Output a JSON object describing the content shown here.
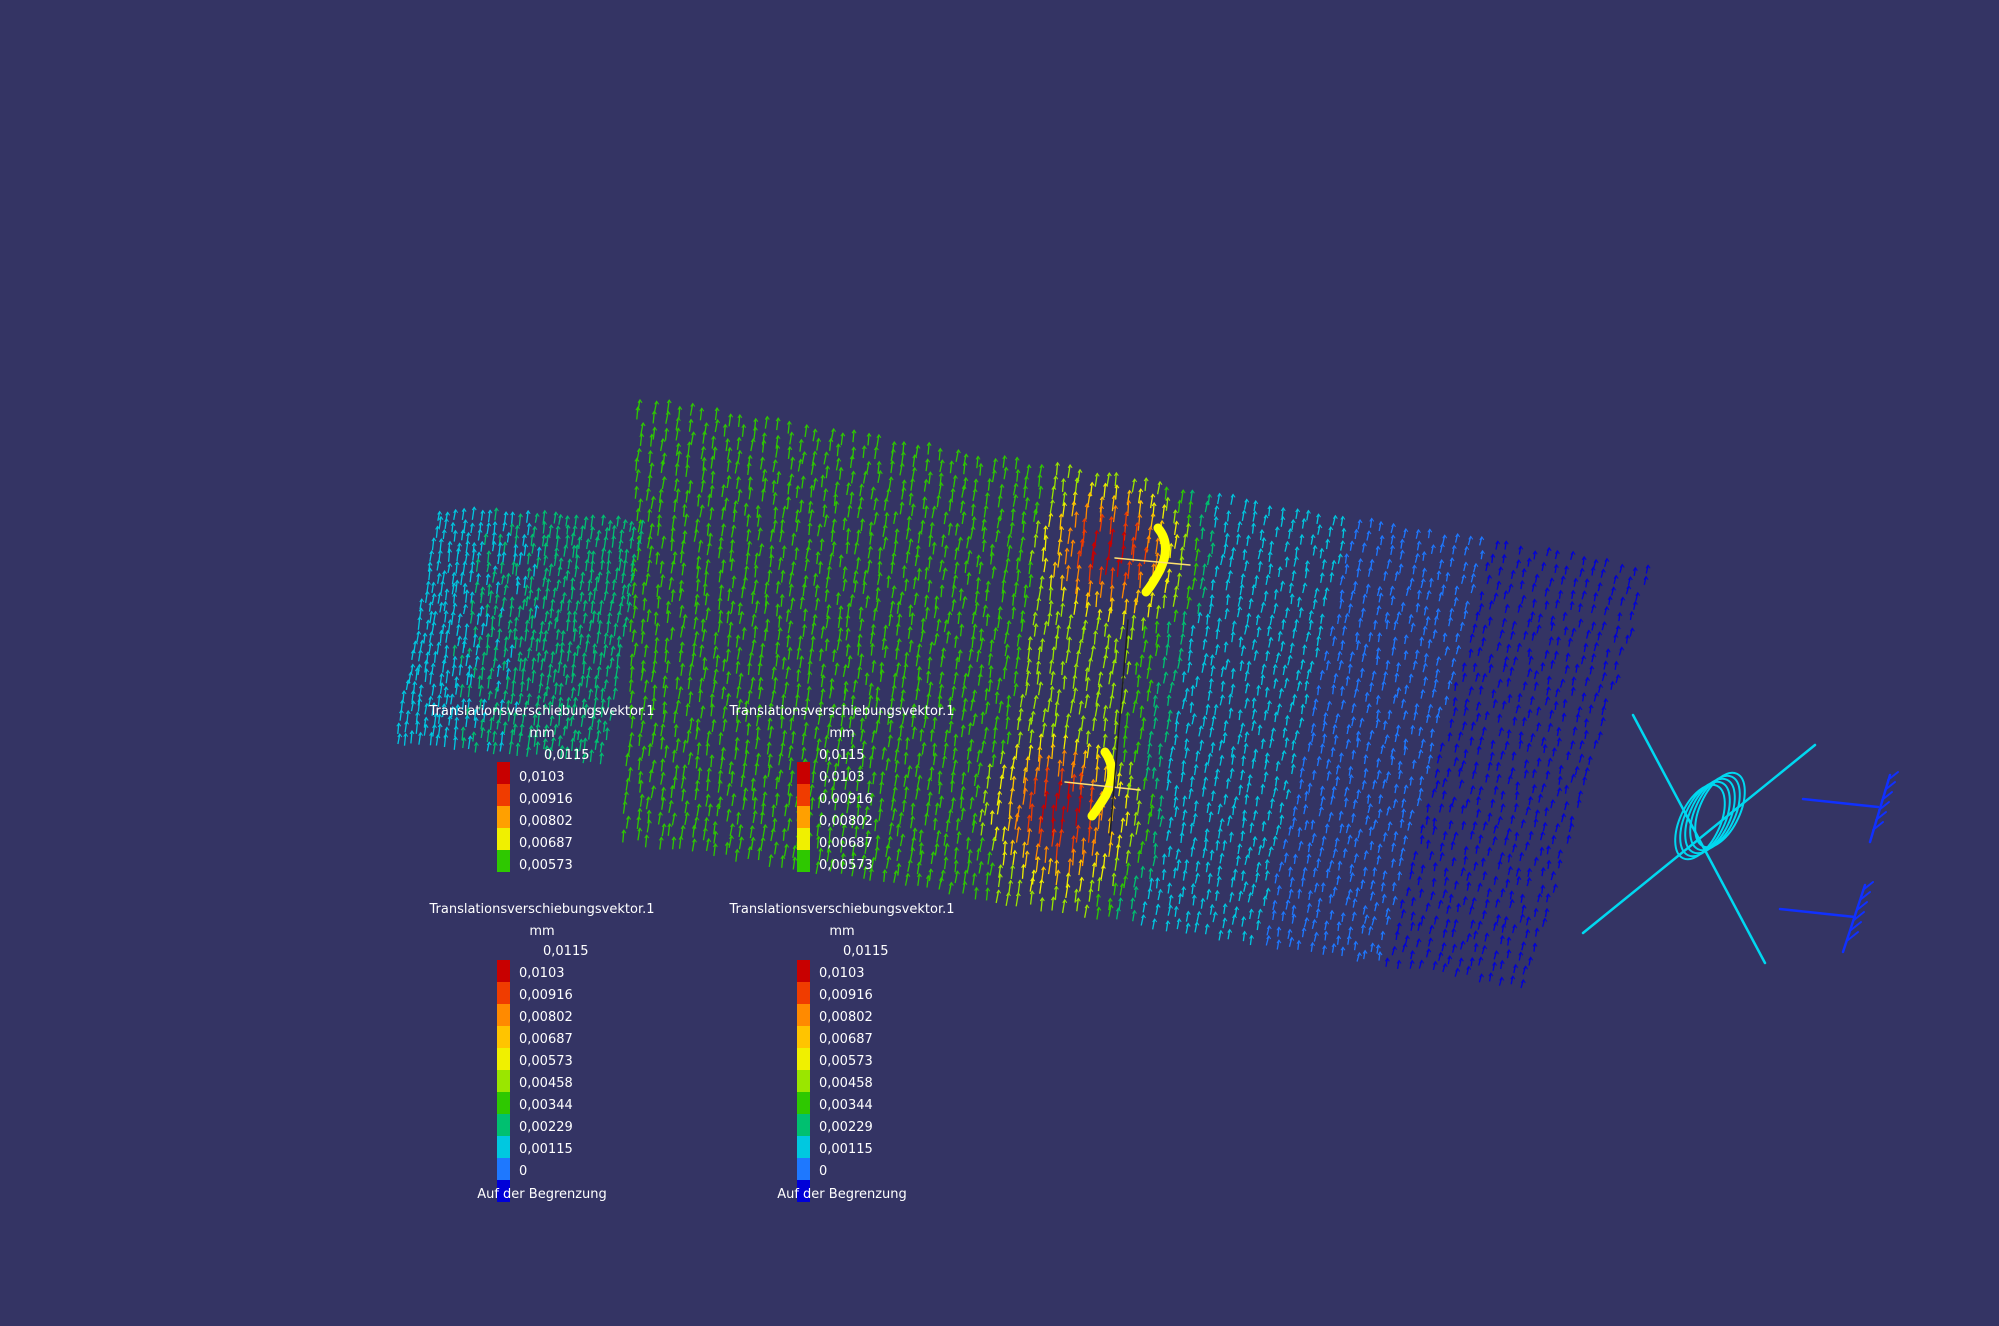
{
  "colors": {
    "background": "#343464",
    "scale": [
      "#c80000",
      "#f03c00",
      "#ff8a00",
      "#ffc400",
      "#f0f000",
      "#9ae600",
      "#2ec800",
      "#00c070",
      "#00c8e0",
      "#1e78ff",
      "#0000d8"
    ],
    "support": "#00d8f0",
    "clamp": "#1030ff",
    "load": "#ffff00"
  },
  "legends": [
    {
      "title": "Translationsverschiebungsvektor.1",
      "unit": "mm",
      "ticks": [
        "0,0115",
        "0,0103",
        "0,00916",
        "0,00802",
        "0,00687",
        "0,00573"
      ],
      "footer": ""
    },
    {
      "title": "Translationsverschiebungsvektor.1",
      "unit": "mm",
      "ticks": [
        "0,0115",
        "0,0103",
        "0,00916",
        "0,00802",
        "0,00687",
        "0,00573"
      ],
      "footer": ""
    },
    {
      "title": "Translationsverschiebungsvektor.1",
      "unit": "mm",
      "ticks": [
        "0,0115",
        "0,0103",
        "0,00916",
        "0,00802",
        "0,00687",
        "0,00573",
        "0,00458",
        "0,00344",
        "0,00229",
        "0,00115",
        "0"
      ],
      "footer": "Auf der Begrenzung"
    },
    {
      "title": "Translationsverschiebungsvektor.1",
      "unit": "mm",
      "ticks": [
        "0,0115",
        "0,0103",
        "0,00916",
        "0,00802",
        "0,00687",
        "0,00573",
        "0,00458",
        "0,00344",
        "0,00229",
        "0,00115",
        "0"
      ],
      "footer": "Auf der Begrenzung"
    }
  ]
}
